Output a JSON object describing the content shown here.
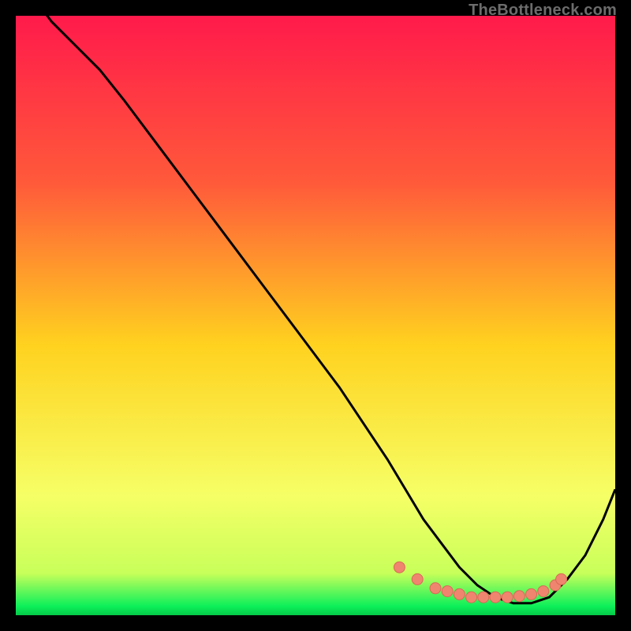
{
  "watermark": "TheBottleneck.com",
  "colors": {
    "grad_top": "#ff1a4b",
    "grad_mid": "#ffd21f",
    "grad_low": "#f6ff66",
    "grad_green": "#0df05a",
    "curve": "#000000",
    "marker_fill": "#f0856f",
    "marker_stroke": "#d96a56"
  },
  "chart_data": {
    "type": "line",
    "title": "",
    "xlabel": "",
    "ylabel": "",
    "xlim": [
      0,
      100
    ],
    "ylim": [
      0,
      100
    ],
    "series": [
      {
        "name": "curve",
        "x": [
          0,
          3,
          6,
          10,
          14,
          18,
          24,
          30,
          36,
          42,
          48,
          54,
          58,
          62,
          65,
          68,
          71,
          74,
          77,
          80,
          83,
          86,
          89,
          92,
          95,
          98,
          100
        ],
        "y": [
          108,
          103,
          99,
          95,
          91,
          86,
          78,
          70,
          62,
          54,
          46,
          38,
          32,
          26,
          21,
          16,
          12,
          8,
          5,
          3,
          2,
          2,
          3,
          6,
          10,
          16,
          21
        ]
      }
    ],
    "markers": {
      "name": "dots",
      "x": [
        64,
        67,
        70,
        72,
        74,
        76,
        78,
        80,
        82,
        84,
        86,
        88,
        90,
        91
      ],
      "y": [
        8,
        6,
        4.5,
        4,
        3.5,
        3,
        3,
        3,
        3,
        3.2,
        3.5,
        4,
        5,
        6
      ]
    },
    "gradient_stops": [
      {
        "offset": 0.0,
        "color": "#ff1a4b"
      },
      {
        "offset": 0.28,
        "color": "#ff5a3a"
      },
      {
        "offset": 0.55,
        "color": "#ffd21f"
      },
      {
        "offset": 0.8,
        "color": "#f6ff66"
      },
      {
        "offset": 0.93,
        "color": "#c8ff5a"
      },
      {
        "offset": 0.985,
        "color": "#0df05a"
      },
      {
        "offset": 1.0,
        "color": "#04c948"
      }
    ]
  }
}
